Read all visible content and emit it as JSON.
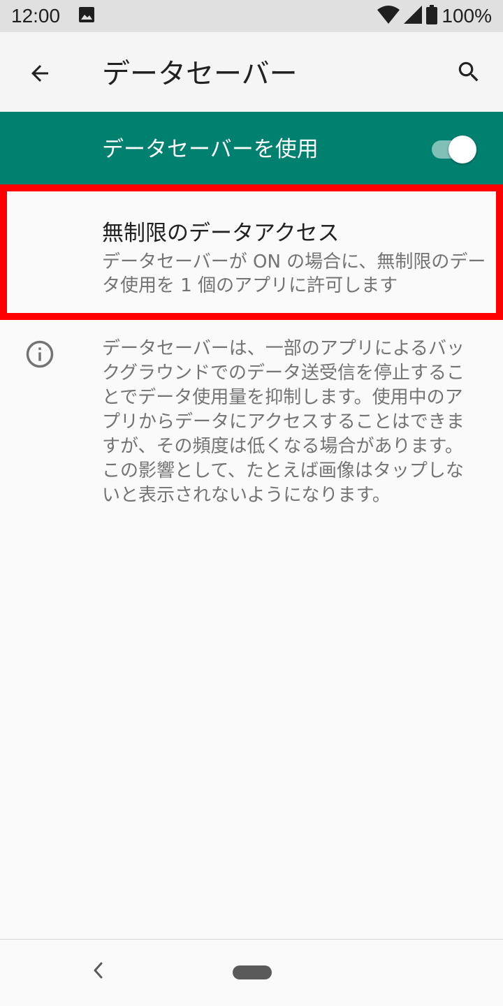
{
  "status_bar": {
    "time": "12:00",
    "battery": "100%",
    "icons": [
      "image-icon",
      "wifi-icon",
      "signal-icon",
      "battery-icon"
    ]
  },
  "app_bar": {
    "title": "データセーバー",
    "icons": [
      "back-arrow-icon",
      "search-icon"
    ]
  },
  "master_switch": {
    "label": "データセーバーを使用",
    "checked": true,
    "color": "#00806f"
  },
  "unrestricted_item": {
    "title": "無制限のデータアクセス",
    "summary": "データセーバーが ON の場合に、無制限のデータ使用を 1 個のアプリに許可します",
    "highlight_color": "#ff0000"
  },
  "footer": {
    "icon": "info-icon",
    "text": "データセーバーは、一部のアプリによるバックグラウンドでのデータ送受信を停止することでデータ使用量を抑制します。使用中のアプリからデータにアクセスすることはできますが、その頻度は低くなる場合があります。この影響として、たとえば画像はタップしないと表示されないようになります。"
  },
  "nav_bar": {
    "icons": [
      "nav-back-icon",
      "nav-home-pill"
    ]
  }
}
